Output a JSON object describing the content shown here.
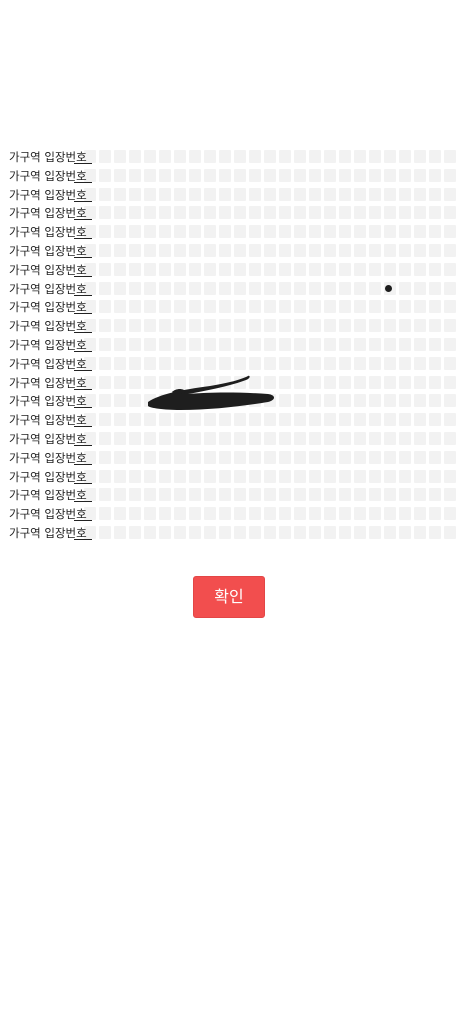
{
  "seat_map": {
    "rows": [
      {
        "label": "가구역 입장번호"
      },
      {
        "label": "가구역 입장번호"
      },
      {
        "label": "가구역 입장번호"
      },
      {
        "label": "가구역 입장번호"
      },
      {
        "label": "가구역 입장번호"
      },
      {
        "label": "가구역 입장번호"
      },
      {
        "label": "가구역 입장번호"
      },
      {
        "label": "가구역 입장번호"
      },
      {
        "label": "가구역 입장번호"
      },
      {
        "label": "가구역 입장번호"
      },
      {
        "label": "가구역 입장번호"
      },
      {
        "label": "가구역 입장번호"
      },
      {
        "label": "가구역 입장번호"
      },
      {
        "label": "가구역 입장번호"
      },
      {
        "label": "가구역 입장번호"
      },
      {
        "label": "가구역 입장번호"
      },
      {
        "label": "가구역 입장번호"
      },
      {
        "label": "가구역 입장번호"
      },
      {
        "label": "가구역 입장번호"
      },
      {
        "label": "가구역 입장번호"
      },
      {
        "label": "가구역 입장번호"
      }
    ],
    "seats_per_row": 25,
    "seat_color": "#f2f2f2",
    "label_color": "#222222"
  },
  "confirm": {
    "label": "확인",
    "color": "#f24e4e"
  },
  "annotation": {
    "scribble_color": "#1e1e1e",
    "dot_color": "#1e1e1e"
  }
}
